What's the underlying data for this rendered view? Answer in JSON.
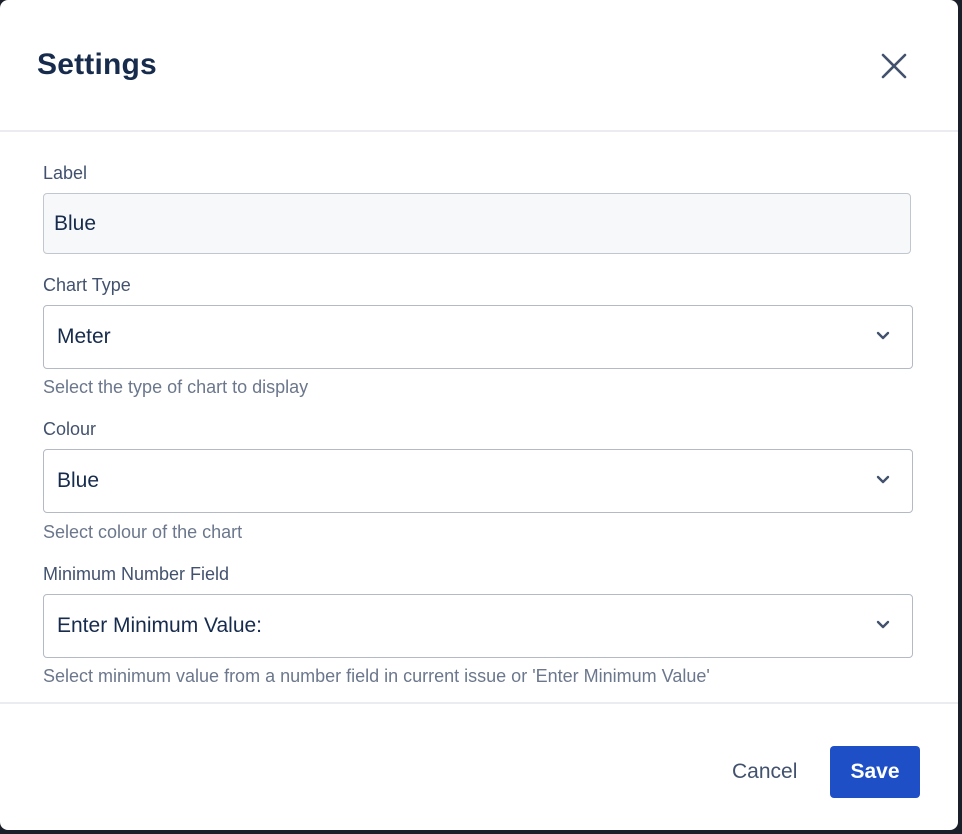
{
  "dialog": {
    "title": "Settings"
  },
  "fields": {
    "label": {
      "label": "Label",
      "value": "Blue"
    },
    "chart_type": {
      "label": "Chart Type",
      "selected": "Meter",
      "helper": "Select the type of chart to display"
    },
    "colour": {
      "label": "Colour",
      "selected": "Blue",
      "helper": "Select colour of the chart"
    },
    "minimum_number_field": {
      "label": "Minimum Number Field",
      "selected": "Enter Minimum Value:",
      "helper": "Select minimum value from a number field in current issue or 'Enter Minimum Value'"
    }
  },
  "footer": {
    "cancel_label": "Cancel",
    "save_label": "Save"
  },
  "icons": {
    "close": "close-icon",
    "chevron": "chevron-down-icon"
  },
  "colors": {
    "primary_button": "#1f4fc7",
    "title_text": "#172b4d",
    "label_text": "#42526e",
    "helper_text": "#6b778c"
  }
}
